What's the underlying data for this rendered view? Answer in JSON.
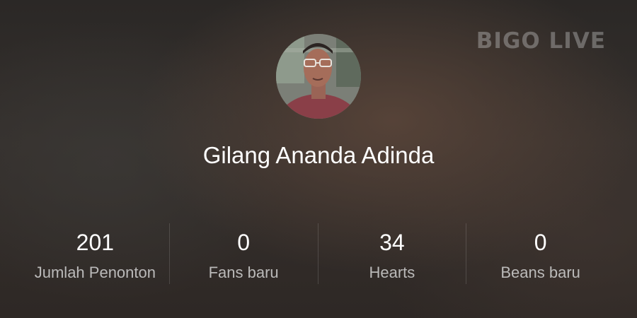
{
  "watermark": "BIGO LIVE",
  "profile": {
    "name": "Gilang Ananda Adinda"
  },
  "stats": [
    {
      "value": "201",
      "label": "Jumlah Penonton"
    },
    {
      "value": "0",
      "label": "Fans baru"
    },
    {
      "value": "34",
      "label": "Hearts"
    },
    {
      "value": "0",
      "label": "Beans baru"
    }
  ]
}
